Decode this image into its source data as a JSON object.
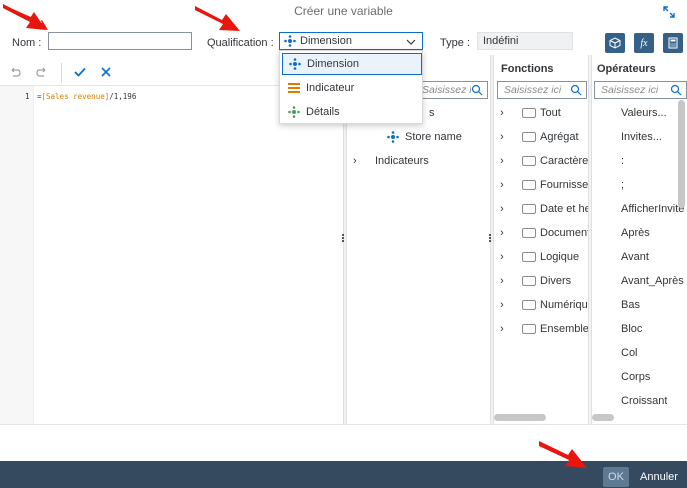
{
  "dialog": {
    "title": "Créer une variable"
  },
  "form": {
    "name_label": "Nom :",
    "name_value": "",
    "qualification_label": "Qualification :",
    "qualification_value": "Dimension",
    "type_label": "Type :",
    "type_value": "Indéfini",
    "dropdown_options": [
      "Dimension",
      "Indicateur",
      "Détails"
    ]
  },
  "editor": {
    "line_number": "1",
    "code_prefix": "=",
    "code_field": "[Sales revenue]",
    "code_suffix": "/1,196"
  },
  "objects_panel": {
    "search_placeholder": "Saisissez le texte pour filtrer",
    "items": [
      {
        "label": "Store name"
      },
      {
        "label": "Indicateurs"
      }
    ],
    "partial_item": "s"
  },
  "functions_panel": {
    "title": "Fonctions",
    "search_placeholder": "Saisissez ici",
    "items": [
      "Tout",
      "Agrégat",
      "Caractère",
      "Fournisseur",
      "Date et heure",
      "Document",
      "Logique",
      "Divers",
      "Numérique",
      "Ensemble"
    ]
  },
  "operators_panel": {
    "title": "Opérateurs",
    "search_placeholder": "Saisissez ici",
    "items": [
      "Valeurs...",
      "Invites...",
      ":",
      ";",
      "AfficherInvite",
      "Après",
      "Avant",
      "Avant_Après",
      "Bas",
      "Bloc",
      "Col",
      "Corps",
      "Croissant"
    ]
  },
  "footer": {
    "ok_label": "OK",
    "cancel_label": "Annuler"
  },
  "colors": {
    "accent": "#0a6ed1",
    "footer_bg": "#354a5f",
    "code_field": "#e07b00",
    "arrow": "#e8160c"
  }
}
